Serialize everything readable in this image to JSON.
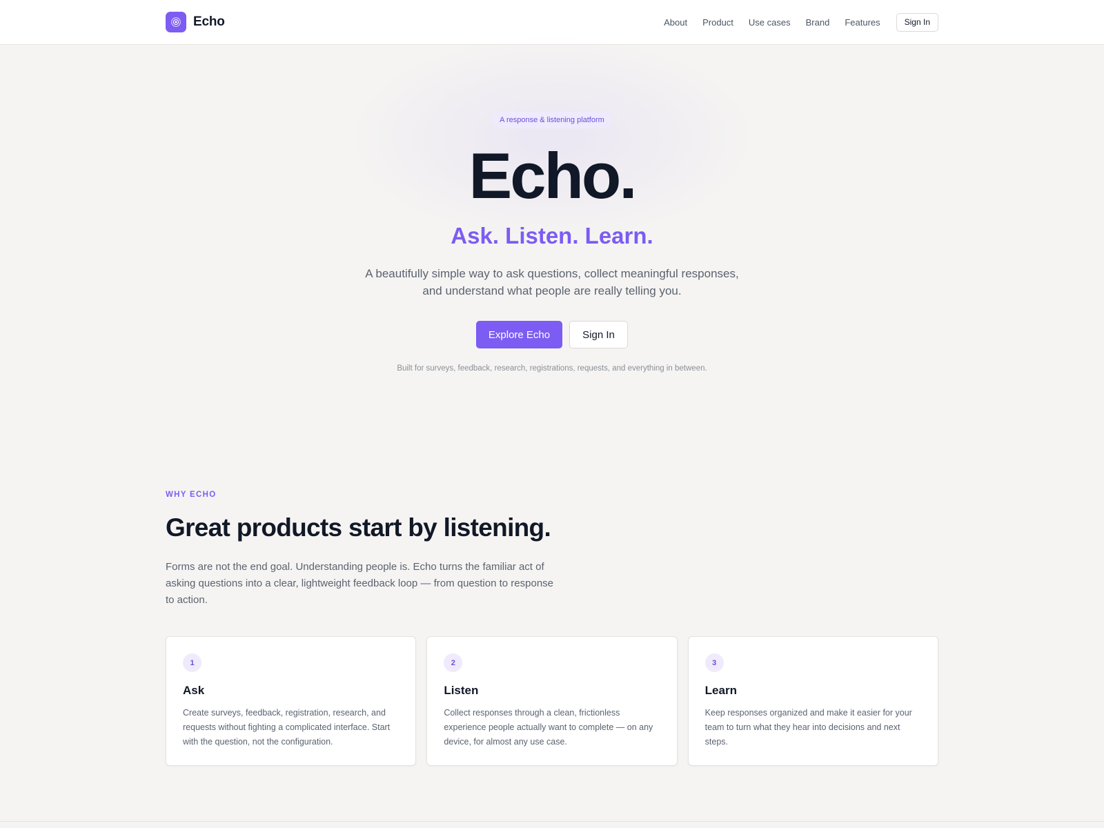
{
  "header": {
    "brand_name": "Echo",
    "brand_icon": "concentric-circles-icon",
    "nav": [
      {
        "label": "About"
      },
      {
        "label": "Product"
      },
      {
        "label": "Use cases"
      },
      {
        "label": "Brand"
      },
      {
        "label": "Features"
      }
    ],
    "signin_label": "Sign In"
  },
  "hero": {
    "badge": "A response & listening platform",
    "title": "Echo.",
    "tagline": "Ask. Listen. Learn.",
    "description": "A beautifully simple way to ask questions, collect meaningful responses, and understand what people are really telling you.",
    "primary_cta": "Explore Echo",
    "secondary_cta": "Sign In",
    "footnote": "Built for surveys, feedback, research, registrations, requests, and everything in between."
  },
  "why": {
    "eyebrow": "WHY ECHO",
    "title": "Great products start by listening.",
    "description": "Forms are not the end goal. Understanding people is. Echo turns the familiar act of asking questions into a clear, lightweight feedback loop — from question to response to action.",
    "cards": [
      {
        "number": "1",
        "title": "Ask",
        "text": "Create surveys, feedback, registration, research, and requests without fighting a complicated interface. Start with the question, not the configuration."
      },
      {
        "number": "2",
        "title": "Listen",
        "text": "Collect responses through a clean, frictionless experience people actually want to complete — on any device, for almost any use case."
      },
      {
        "number": "3",
        "title": "Learn",
        "text": "Keep responses organized and make it easier for your team to turn what they hear into decisions and next steps."
      }
    ]
  },
  "colors": {
    "accent": "#7c5cf2",
    "background": "#f5f4f2",
    "text": "#111827",
    "muted": "#5b6270"
  }
}
